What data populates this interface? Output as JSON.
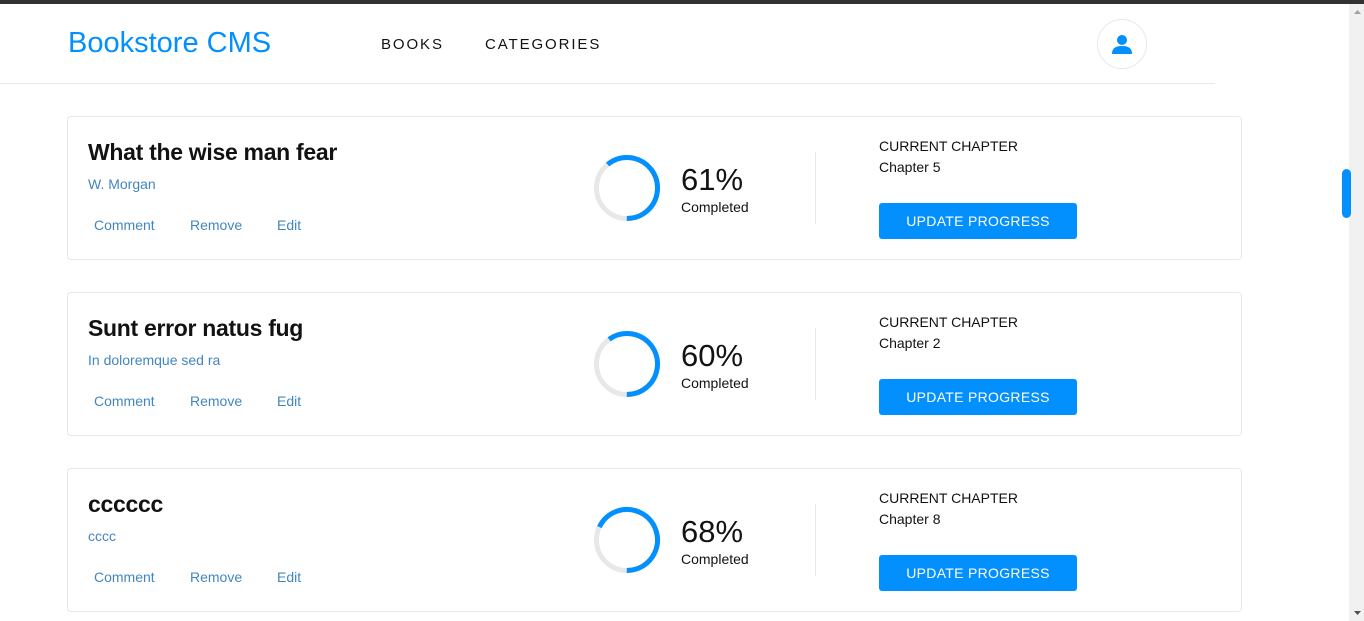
{
  "header": {
    "logo": "Bookstore CMS",
    "nav": [
      "BOOKS",
      "CATEGORIES"
    ],
    "user_icon": "user-icon"
  },
  "colors": {
    "accent": "#0290ff",
    "link": "#4386bf",
    "ring_track": "#e8e8e8",
    "text": "#121212"
  },
  "books": [
    {
      "title": "What the wise man fear",
      "author": "W. Morgan",
      "actions": [
        "Comment",
        "Remove",
        "Edit"
      ],
      "progress": 61,
      "percent_label": "61%",
      "completed_label": "Completed",
      "chapter_label": "CURRENT CHAPTER",
      "chapter": "Chapter 5",
      "button": "UPDATE PROGRESS"
    },
    {
      "title": "Sunt error natus fug",
      "author": "In doloremque sed ra",
      "actions": [
        "Comment",
        "Remove",
        "Edit"
      ],
      "progress": 60,
      "percent_label": "60%",
      "completed_label": "Completed",
      "chapter_label": "CURRENT CHAPTER",
      "chapter": "Chapter 2",
      "button": "UPDATE PROGRESS"
    },
    {
      "title": "cccccc",
      "author": "cccc",
      "actions": [
        "Comment",
        "Remove",
        "Edit"
      ],
      "progress": 68,
      "percent_label": "68%",
      "completed_label": "Completed",
      "chapter_label": "CURRENT CHAPTER",
      "chapter": "Chapter 8",
      "button": "UPDATE PROGRESS"
    }
  ]
}
